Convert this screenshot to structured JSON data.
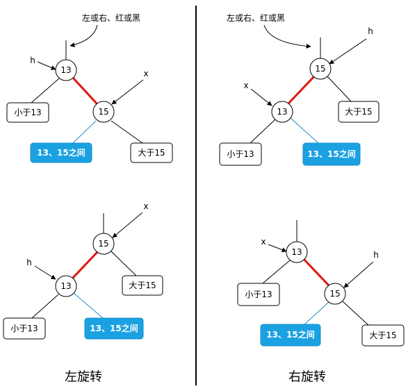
{
  "annotation": "左或右、红或黑",
  "nodes": {
    "n13": "13",
    "n15": "15"
  },
  "boxes": {
    "less": "小于13",
    "between": "13、15之间",
    "greater": "大于15"
  },
  "pointers": {
    "h": "h",
    "x": "x"
  },
  "captions": {
    "left": "左旋转",
    "right": "右旋转"
  },
  "colors": {
    "red_link": "#e0150c",
    "highlight": "#1ba1e2"
  }
}
